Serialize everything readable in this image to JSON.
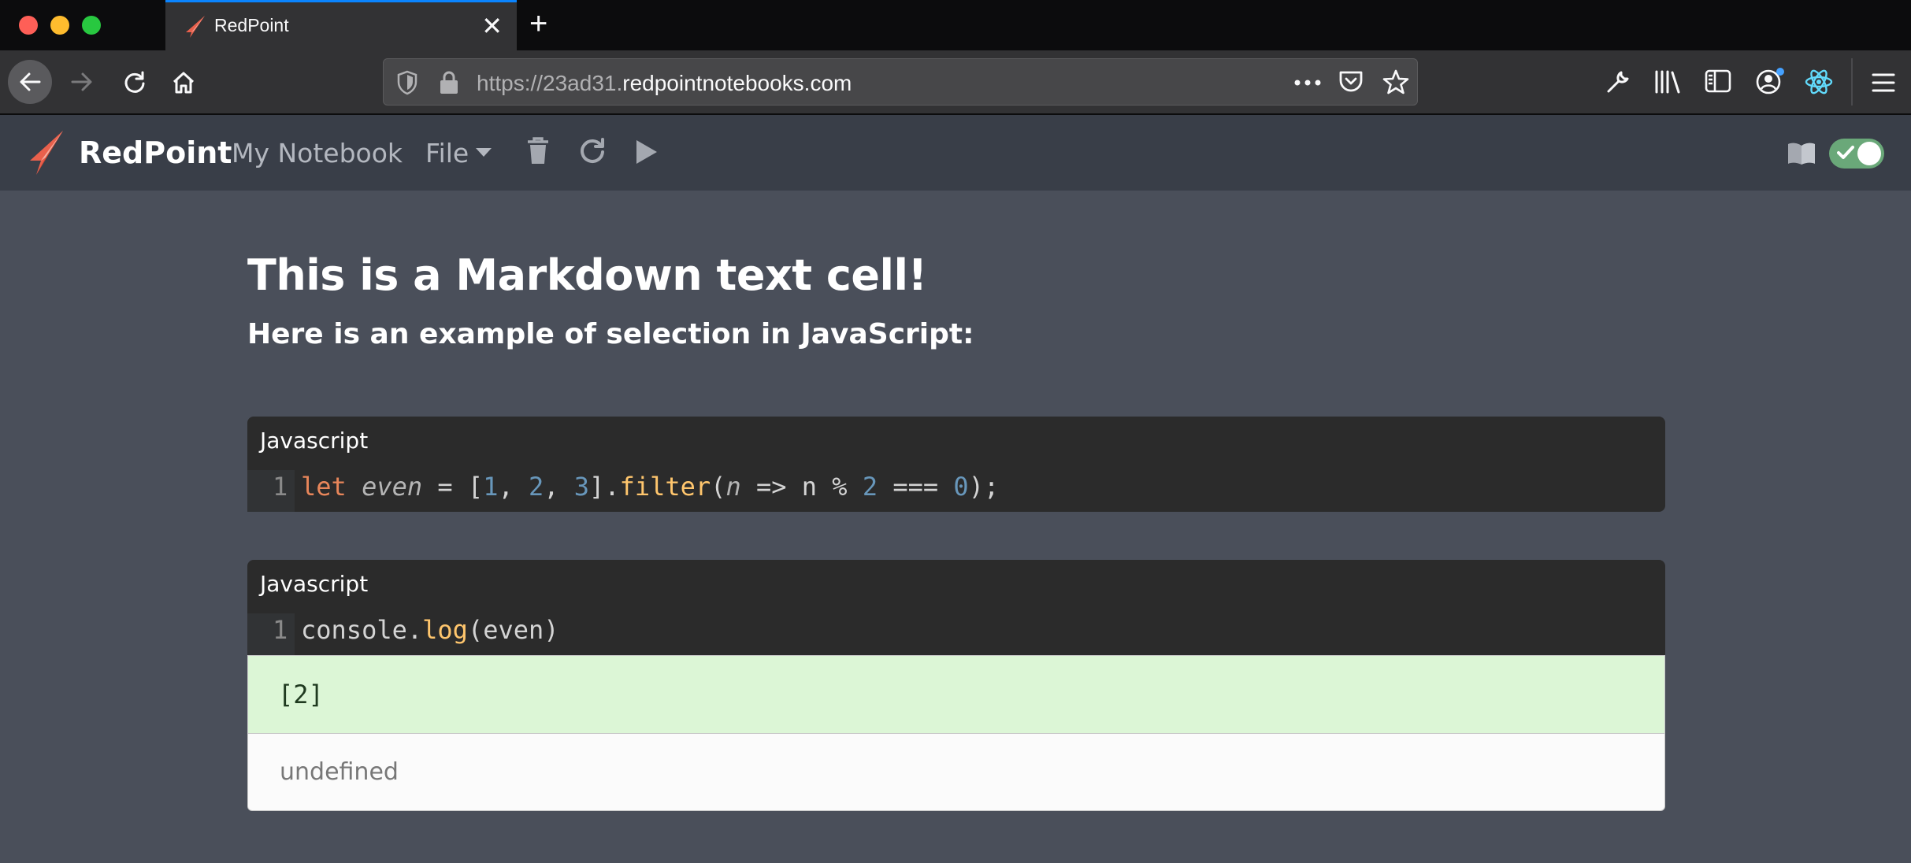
{
  "browser": {
    "tab_title": "RedPoint",
    "tab_close": "✕",
    "new_tab": "+",
    "url_prefix": "https://23ad31.",
    "url_domain": "redpointnotebooks.com"
  },
  "app": {
    "brand": "RedPoint",
    "notebook_name": "My Notebook",
    "file_menu": "File",
    "accent_color": "#e9604c",
    "toggle_on": true
  },
  "markdown": {
    "heading": "This is a Markdown text cell!",
    "subheading": "Here is an example of selection in JavaScript:"
  },
  "cells": [
    {
      "language": "Javascript",
      "line_number": "1",
      "tokens": {
        "kw": "let",
        "var": "even",
        "eq": " = [",
        "n1": "1",
        "c1": ", ",
        "n2": "2",
        "c2": ", ",
        "n3": "3",
        "dot": "].",
        "fn": "filter",
        "open": "(",
        "param": "n",
        "arrow": " => n % ",
        "n4": "2",
        "cmp": " === ",
        "n5": "0",
        "end": ");"
      }
    },
    {
      "language": "Javascript",
      "line_number": "1",
      "tokens": {
        "obj": "console.",
        "fn": "log",
        "args": "(even)"
      },
      "output": {
        "stdout": "[2]",
        "return_value": "undefined"
      }
    }
  ]
}
